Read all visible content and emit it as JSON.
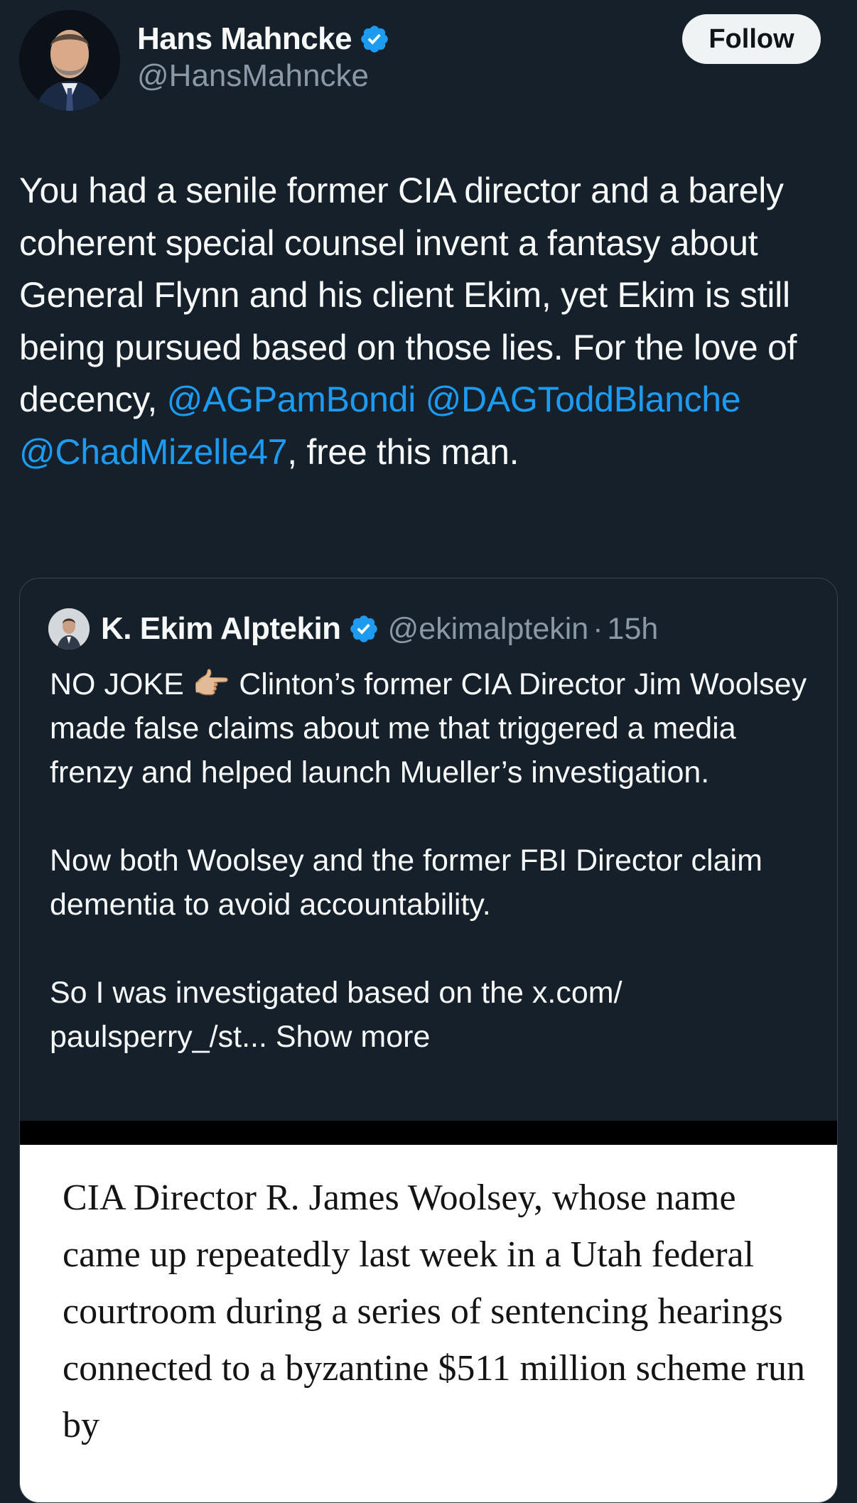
{
  "author": {
    "display_name": "Hans Mahncke",
    "handle": "@HansMahncke",
    "verified_icon": "verified-badge-icon",
    "follow_label": "Follow"
  },
  "tweet": {
    "text_before": "You had a senile former CIA director and a barely coherent special counsel invent a fantasy about General Flynn and his client Ekim, yet Ekim is still being pursued based on those lies. For the love of decency, ",
    "mention_1": "@AGPamBondi",
    "mention_2": "@DAGToddBlanche",
    "mention_3": "@ChadMizelle47",
    "text_after": ", free this man."
  },
  "quoted": {
    "display_name": "K. Ekim Alptekin",
    "handle": "@ekimalptekin",
    "separator": "·",
    "time": "15h",
    "p1_before_emoji": "NO JOKE ",
    "emoji": "👉🏼",
    "p1_after_emoji": " Clinton’s former CIA Director Jim Woolsey made false claims about me that triggered a media frenzy and helped launch Mueller’s investigation.",
    "p2": "Now both Woolsey and the former FBI Director claim dementia to avoid accountability.",
    "p3": "So I was investigated based on the x.com/ paulsperry_/st...",
    "show_more": "Show more",
    "media_text": "CIA Director R. James Woolsey, whose name came up repeatedly last week in a Utah federal courtroom during a series of sentencing hearings connected to a byzantine $511 million scheme run by"
  },
  "colors": {
    "background": "#15202b",
    "text": "#f7f9f9",
    "secondary": "#8b98a5",
    "accent": "#1d9bf0",
    "border": "#38444d"
  }
}
